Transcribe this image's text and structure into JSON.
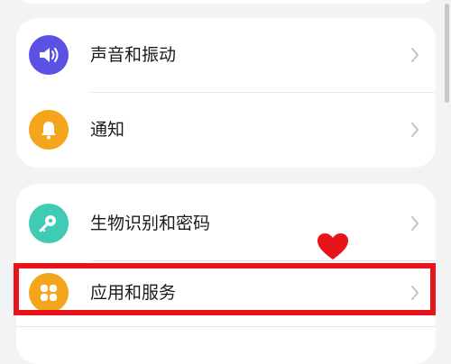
{
  "colors": {
    "background": "#f1f3f5",
    "card": "#ffffff",
    "sound_icon_bg": "#5b52e3",
    "notification_icon_bg": "#f4a51c",
    "biometrics_icon_bg": "#3fcbb4",
    "apps_icon_bg": "#f4a51c",
    "annotation_red": "#e8141b"
  },
  "settings": {
    "group1": [
      {
        "label": "声音和振动",
        "icon": "speaker-icon"
      },
      {
        "label": "通知",
        "icon": "bell-icon"
      }
    ],
    "group2": [
      {
        "label": "生物识别和密码",
        "icon": "key-icon"
      },
      {
        "label": "应用和服务",
        "icon": "apps-grid-icon"
      }
    ]
  },
  "annotation": {
    "highlighted_item": "应用和服务",
    "marker": "heart"
  }
}
